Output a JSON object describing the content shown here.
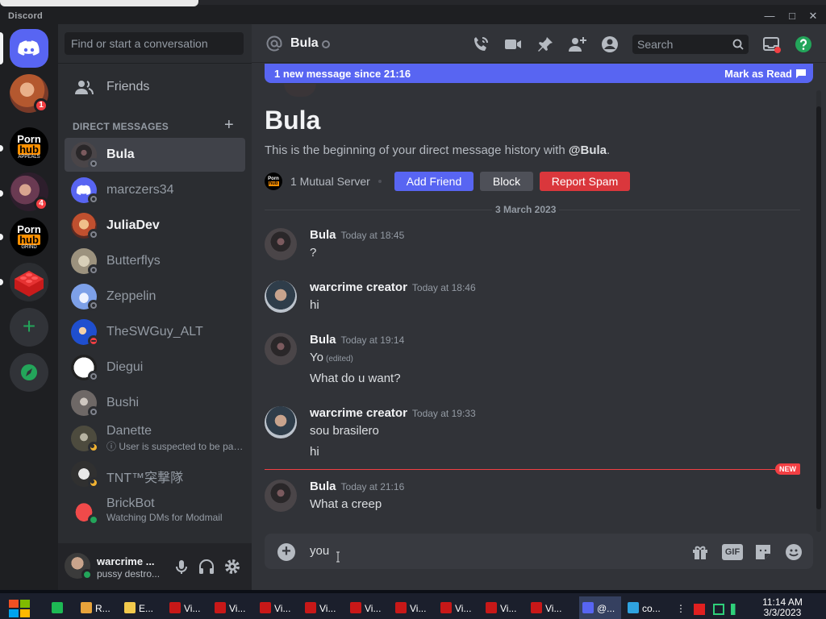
{
  "window": {
    "title": "Discord"
  },
  "colors": {
    "accent": "#5865f2",
    "danger": "#da373c",
    "online": "#23a55a",
    "bg_main": "#313338",
    "bg_sidebar": "#2b2d31"
  },
  "server_rail": {
    "home_icon": "discord-logo-icon",
    "servers": [
      {
        "badge": "1"
      },
      {
        "label": [
          "Porn",
          "hub",
          "APPEALS"
        ]
      },
      {
        "badge": "4"
      },
      {
        "label": [
          "Porn",
          "hub",
          "GRIND"
        ]
      },
      {
        "icon": "red-brick-icon"
      }
    ],
    "add_server_icon": "plus-icon",
    "explore_icon": "compass-icon"
  },
  "sidebar": {
    "search_placeholder": "Find or start a conversation",
    "friends_label": "Friends",
    "dm_header": "DIRECT MESSAGES",
    "dm_add": "+",
    "dms": [
      {
        "name": "Bula",
        "status": "offline",
        "active": true
      },
      {
        "name": "marczers34",
        "status": "offline"
      },
      {
        "name": "JuliaDev",
        "status": "offline",
        "unread": true
      },
      {
        "name": "Butterflys",
        "status": "offline"
      },
      {
        "name": "Zeppelin",
        "status": "offline"
      },
      {
        "name": "TheSWGuy_ALT",
        "status": "dnd"
      },
      {
        "name": "Diegui",
        "status": "offline"
      },
      {
        "name": "Bushi",
        "status": "offline"
      },
      {
        "name": "Danette",
        "subtitle": "ⓘ User is suspected to be par...",
        "status": "idle"
      },
      {
        "name": "TNT™突撃隊",
        "status": "idle"
      },
      {
        "name": "BrickBot",
        "subtitle": "Watching DMs for Modmail",
        "status": "online"
      }
    ]
  },
  "user_panel": {
    "username": "warcrime ...",
    "status_text": "pussy destro...",
    "mic_icon": "microphone-icon",
    "headset_icon": "headphones-icon",
    "settings_icon": "gear-icon"
  },
  "header": {
    "title": "Bula",
    "icons": [
      "call-icon",
      "video-icon",
      "pin-icon",
      "add-friend-icon",
      "profile-icon"
    ],
    "search_placeholder": "Search",
    "inbox_icon": "inbox-icon",
    "help_icon": "help-icon"
  },
  "new_banner": {
    "text": "1 new message since 21:16",
    "action": "Mark as Read"
  },
  "welcome": {
    "title": "Bula",
    "text_prefix": "This is the beginning of your direct message history with ",
    "text_user": "@Bula",
    "text_suffix": ".",
    "mutual": "1 Mutual Server",
    "mutual_icon": [
      "Porn",
      "hub"
    ],
    "add_friend": "Add Friend",
    "block": "Block",
    "report_spam": "Report Spam"
  },
  "date_divider": "3 March 2023",
  "messages": [
    {
      "author": "Bula",
      "time": "Today at 18:45",
      "lines": [
        "?"
      ]
    },
    {
      "author": "warcrime creator",
      "time": "Today at 18:46",
      "lines": [
        "hi"
      ]
    },
    {
      "author": "Bula",
      "time": "Today at 19:14",
      "lines": [
        "Yo",
        "What do u want?"
      ],
      "edited": "(edited)"
    },
    {
      "author": "warcrime creator",
      "time": "Today at 19:33",
      "lines": [
        "sou brasilero",
        "hi"
      ]
    },
    {
      "author": "Bula",
      "time": "Today at 21:16",
      "lines": [
        "What a creep"
      ]
    }
  ],
  "new_divider": "NEW",
  "composer": {
    "value": "you",
    "icons": [
      "gift-icon",
      "gif-icon",
      "sticker-icon",
      "emoji-icon"
    ],
    "gif_label": "GIF",
    "plus": "+"
  },
  "taskbar": {
    "items": [
      {
        "icon": "spotify-icon",
        "label": ""
      },
      {
        "icon": "chrome-icon",
        "label": "R..."
      },
      {
        "icon": "file-explorer-icon",
        "label": "E..."
      },
      {
        "icon": "video-app-icon",
        "label": "Vi..."
      },
      {
        "icon": "video-app-icon",
        "label": "Vi..."
      },
      {
        "icon": "video-app-icon",
        "label": "Vi..."
      },
      {
        "icon": "video-app-icon",
        "label": "Vi..."
      },
      {
        "icon": "video-app-icon",
        "label": "Vi..."
      },
      {
        "icon": "video-app-icon",
        "label": "Vi..."
      },
      {
        "icon": "video-app-icon",
        "label": "Vi..."
      },
      {
        "icon": "video-app-icon",
        "label": "Vi..."
      },
      {
        "icon": "video-app-icon",
        "label": "Vi..."
      },
      {
        "icon": "discord-icon",
        "label": "@..."
      },
      {
        "icon": "code-editor-icon",
        "label": "co..."
      }
    ],
    "time": "11:14 AM",
    "date": "3/3/2023"
  }
}
